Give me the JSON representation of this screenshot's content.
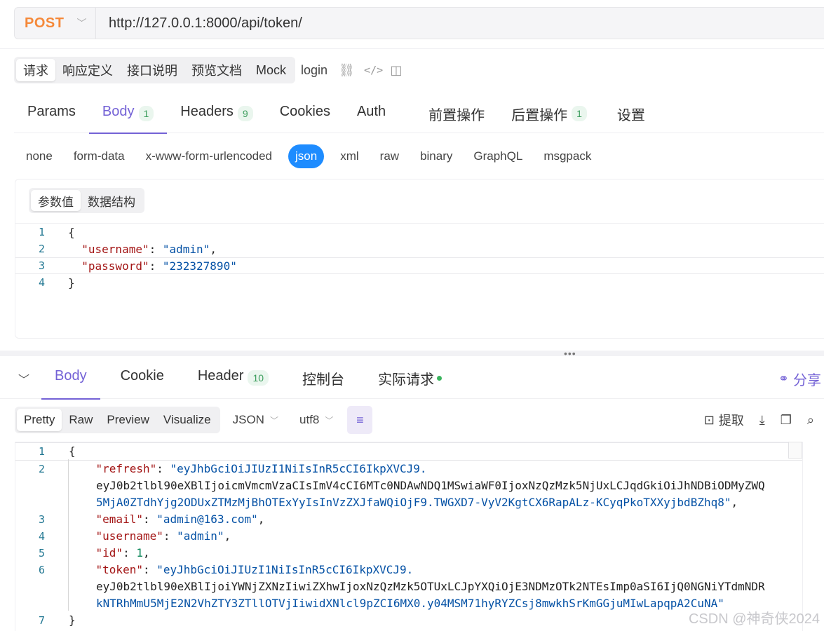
{
  "request": {
    "method": "POST",
    "url": "http://127.0.0.1:8000/api/token/",
    "name": "login"
  },
  "top_segments": [
    "请求",
    "响应定义",
    "接口说明",
    "预览文档",
    "Mock"
  ],
  "tabs": [
    {
      "label": "Params",
      "badge": ""
    },
    {
      "label": "Body",
      "badge": "1"
    },
    {
      "label": "Headers",
      "badge": "9"
    },
    {
      "label": "Cookies",
      "badge": ""
    },
    {
      "label": "Auth",
      "badge": ""
    },
    {
      "label": "前置操作",
      "badge": ""
    },
    {
      "label": "后置操作",
      "badge": "1"
    },
    {
      "label": "设置",
      "badge": ""
    }
  ],
  "body_types": [
    "none",
    "form-data",
    "x-www-form-urlencoded",
    "json",
    "xml",
    "raw",
    "binary",
    "GraphQL",
    "msgpack"
  ],
  "body_active_type": "json",
  "body_subtabs": [
    "参数值",
    "数据结构"
  ],
  "request_body": {
    "username": "admin",
    "password": "232327890"
  },
  "response_tabs": [
    {
      "label": "Body",
      "badge": ""
    },
    {
      "label": "Cookie",
      "badge": ""
    },
    {
      "label": "Header",
      "badge": "10"
    },
    {
      "label": "控制台",
      "badge": ""
    },
    {
      "label": "实际请求",
      "badge": ""
    }
  ],
  "share_label": "分享",
  "view_modes": [
    "Pretty",
    "Raw",
    "Preview",
    "Visualize"
  ],
  "format": "JSON",
  "encoding": "utf8",
  "extract_label": "提取",
  "response_body": {
    "refresh_lines": [
      "eyJhbGciOiJIUzI1NiIsInR5cCI6IkpXVCJ9.",
      "eyJ0b2tlbl90eXBlIjoicmVmcmVzaCIsImV4cCI6MTc0NDAwNDQ1MSwiaWF0IjoxNzQzMzk5NjUxLCJqdGkiOiJhNDBiODMyZWQ",
      "5MjA0ZTdhYjg2ODUxZTMzMjBhOTExYyIsInVzZXJfaWQiOjF9.TWGXD7-VyV2KgtCX6RapALz-KCyqPkoTXXyjbdBZhq8"
    ],
    "email": "admin@163.com",
    "username": "admin",
    "id": "1",
    "token_lines": [
      "eyJhbGciOiJIUzI1NiIsInR5cCI6IkpXVCJ9.",
      "eyJ0b2tlbl90eXBlIjoiYWNjZXNzIiwiZXhwIjoxNzQzMzk5OTUxLCJpYXQiOjE3NDMzOTk2NTEsImp0aSI6IjQ0NGNiYTdmNDR",
      "kNTRhMmU5MjE2N2VhZTY3ZTllOTVjIiwidXNlcl9pZCI6MX0.y04MSM71hyRYZCsj8mwkhSrKmGGjuMIwLapqpA2CuNA"
    ]
  },
  "watermark": "CSDN @神奇侠2024"
}
